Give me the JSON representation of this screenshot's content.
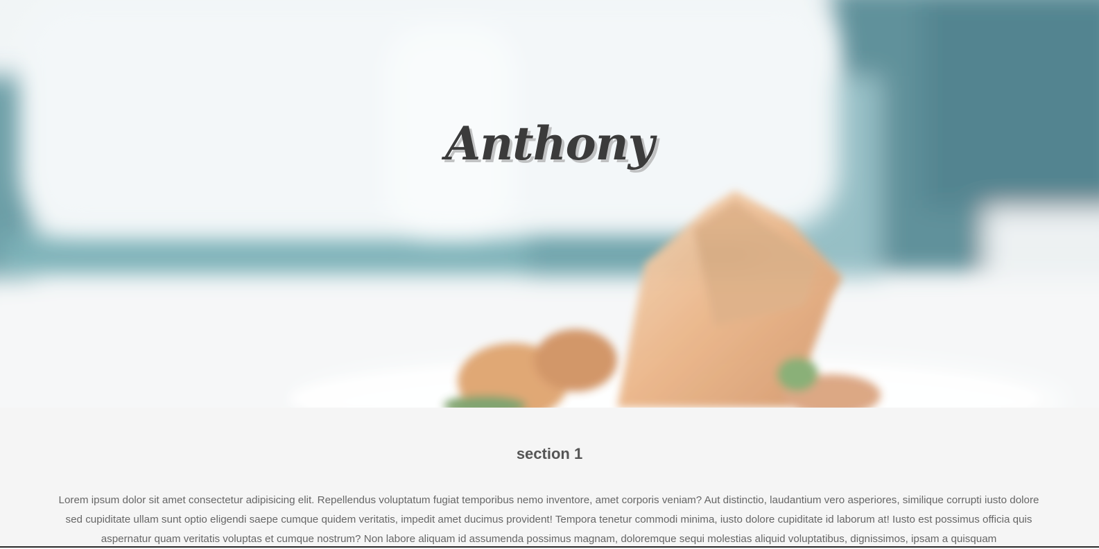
{
  "hero": {
    "title": "Anthony",
    "image": "blurred restaurant table with pastry dish"
  },
  "section": {
    "title": "section 1",
    "body": "Lorem ipsum dolor sit amet consectetur adipisicing elit. Repellendus voluptatum fugiat temporibus nemo inventore, amet corporis veniam? Aut distinctio, laudantium vero asperiores, similique corrupti iusto dolore sed cupiditate ullam sunt optio eligendi saepe cumque quidem veritatis, impedit amet ducimus provident! Tempora tenetur commodi minima, iusto dolore cupiditate id laborum at! Iusto est possimus officia quis aspernatur quam veritatis voluptas et cumque nostrum? Non labore aliquam id assumenda possimus magnam, doloremque sequi molestias aliquid voluptatibus, dignissimos, ipsam a quisquam"
  },
  "colors": {
    "title_text": "#3b3b3b",
    "section_bg": "#f5f5f5",
    "section_title": "#555555",
    "body_text": "#666666"
  }
}
